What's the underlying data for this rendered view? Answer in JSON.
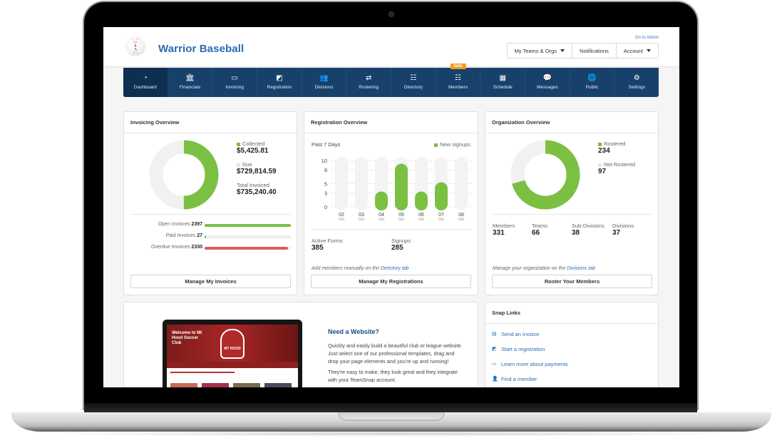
{
  "header": {
    "org_name": "Warrior Baseball",
    "go_to_admin": "Go to Admin",
    "buttons": [
      {
        "label": "My Teams & Orgs",
        "dropdown": true
      },
      {
        "label": "Notifications",
        "dropdown": false
      },
      {
        "label": "Account",
        "dropdown": true
      }
    ]
  },
  "nav": {
    "items": [
      {
        "label": "Dashboard",
        "icon": "dashboard-icon",
        "glyph": "◔",
        "active": true
      },
      {
        "label": "Financials",
        "icon": "bank-icon",
        "glyph": "🏛",
        "active": false
      },
      {
        "label": "Invoicing",
        "icon": "credit-card-icon",
        "glyph": "▭",
        "active": false
      },
      {
        "label": "Registration",
        "icon": "registration-icon",
        "glyph": "◩",
        "active": false
      },
      {
        "label": "Divisions",
        "icon": "group-icon",
        "glyph": "👥",
        "active": false
      },
      {
        "label": "Rostering",
        "icon": "signpost-icon",
        "glyph": "⇄",
        "active": false
      },
      {
        "label": "Directory",
        "icon": "directory-icon",
        "glyph": "☷",
        "active": false
      },
      {
        "label": "Members",
        "icon": "members-icon",
        "glyph": "☷",
        "active": false,
        "badge": "beta"
      },
      {
        "label": "Schedule",
        "icon": "calendar-icon",
        "glyph": "▦",
        "active": false
      },
      {
        "label": "Messages",
        "icon": "chat-bubble-icon",
        "glyph": "💬",
        "active": false
      },
      {
        "label": "Public",
        "icon": "globe-icon",
        "glyph": "🌐",
        "active": false
      },
      {
        "label": "Settings",
        "icon": "gear-icon",
        "glyph": "⚙",
        "active": false
      }
    ]
  },
  "colors": {
    "green": "#7cc043",
    "light": "#f1f1f1",
    "red": "#e05a5a",
    "navy": "#17416b",
    "link": "#2a6db5",
    "beta": "#f39a1f"
  },
  "invoicing": {
    "title": "Invoicing Overview",
    "collected_label": "Collected",
    "collected_value": "$5,425.81",
    "due_label": "Due",
    "due_value": "$729,814.59",
    "total_label": "Total Invoiced",
    "total_value": "$735,240.40",
    "donut_collected_fraction": 0.5,
    "rows": [
      {
        "label": "Open Invoices",
        "count": "2397",
        "fraction": 1.0,
        "color": "#7cc043"
      },
      {
        "label": "Paid Invoices",
        "count": "27",
        "fraction": 0.012,
        "color": "#7cc043"
      },
      {
        "label": "Overdue Invoices",
        "count": "2330",
        "fraction": 0.97,
        "color": "#e05a5a"
      }
    ],
    "button": "Manage My Invoices"
  },
  "registration": {
    "title": "Registration Overview",
    "period": "Past 7 Days",
    "legend": "New signups",
    "active_forms_label": "Active Forms",
    "active_forms_value": "385",
    "signups_label": "Signups",
    "signups_value": "285",
    "note_prefix": "Add members manually on the ",
    "note_link": "Directory tab",
    "button": "Manage My Registrations"
  },
  "chart_data": {
    "type": "bar",
    "title": "Past 7 Days",
    "legend": [
      "New signups"
    ],
    "categories": [
      "02 Oct",
      "03 Oct",
      "04 Oct",
      "05 Oct",
      "06 Oct",
      "07 Oct",
      "08 Oct"
    ],
    "days": [
      "02",
      "03",
      "04",
      "05",
      "06",
      "07",
      "08"
    ],
    "month": "Oct",
    "values": [
      0,
      0,
      3,
      9,
      3,
      5,
      0
    ],
    "yticks": [
      "10",
      "8",
      "5",
      "3",
      "0"
    ],
    "ylim": [
      0,
      10
    ],
    "grid": true
  },
  "organization": {
    "title": "Organization Overview",
    "rostered_label": "Rostered",
    "rostered_value": "234",
    "not_rostered_label": "Not Rostered",
    "not_rostered_value": "97",
    "stats": [
      {
        "label": "Members",
        "value": "331"
      },
      {
        "label": "Teams",
        "value": "66"
      },
      {
        "label": "Sub-Divisions",
        "value": "38"
      },
      {
        "label": "Divisions",
        "value": "37"
      }
    ],
    "note_prefix": "Manage your organization on the ",
    "note_link": "Divisions tab",
    "button": "Roster Your Members"
  },
  "website_promo": {
    "title": "Need a Website?",
    "paragraph1": "Quickly and easily build a beautiful club or league website. Just select one of our professional templates, drag and drop your page elements and you're up and running!",
    "paragraph2": "They're easy to make, they look great and they integrate with your TeamSnap account.",
    "mock_site_title": "Welcome to Mt Hood Soccer Club",
    "mock_badge": "MT HOOD"
  },
  "snap_links": {
    "title": "Snap Links",
    "items": [
      {
        "label": "Send an invoice",
        "icon": "invoice-icon",
        "glyph": "▤"
      },
      {
        "label": "Start a registration",
        "icon": "registration-icon",
        "glyph": "◩"
      },
      {
        "label": "Learn more about payments",
        "icon": "credit-card-icon",
        "glyph": "▭"
      },
      {
        "label": "Find a member",
        "icon": "member-search-icon",
        "glyph": "👤"
      }
    ]
  }
}
